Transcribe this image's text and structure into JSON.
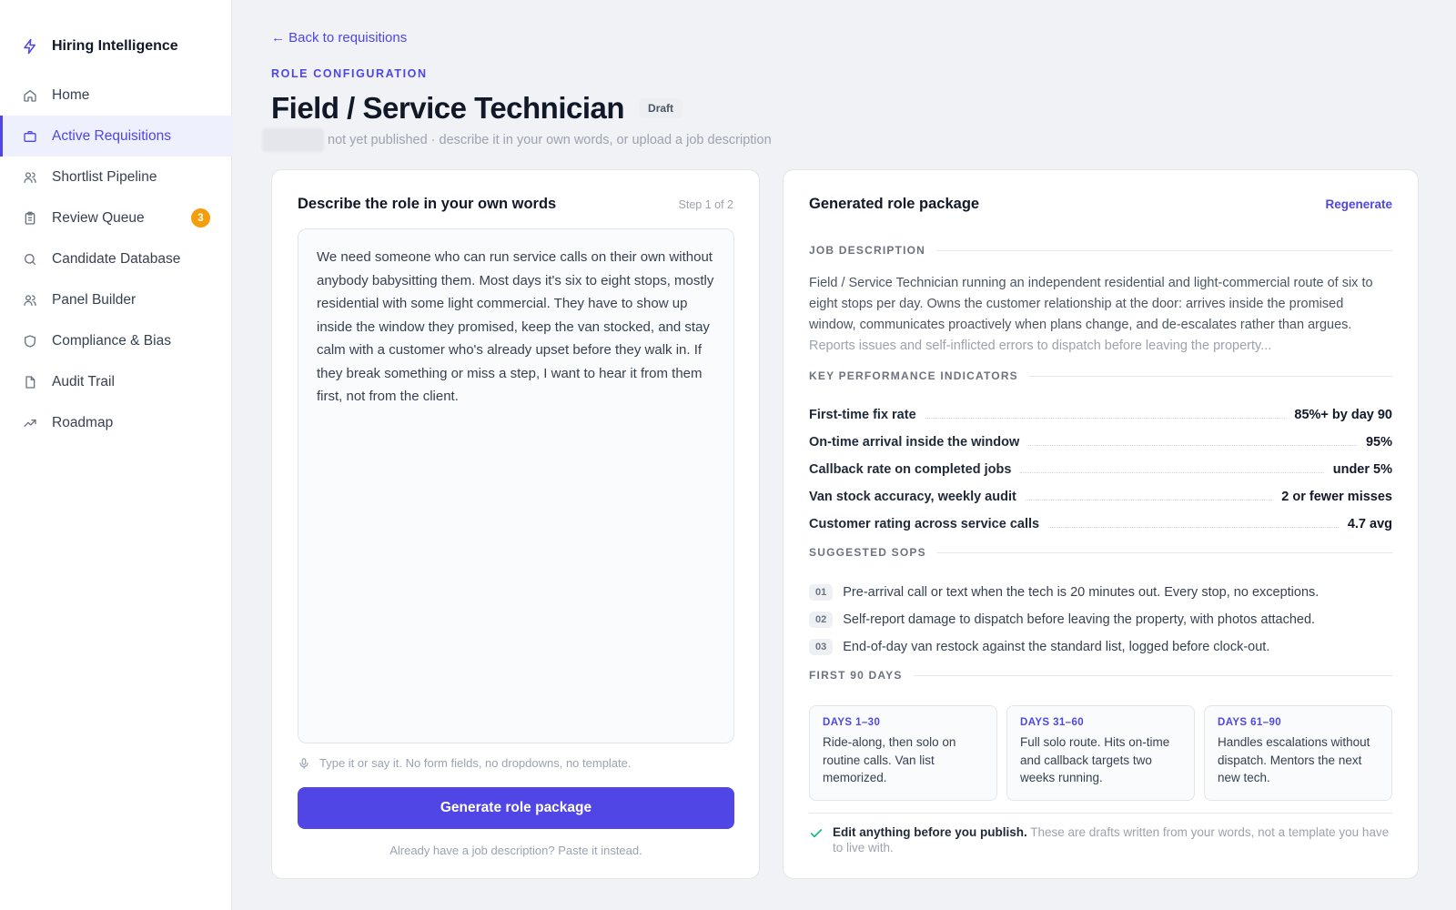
{
  "app": {
    "name": "Hiring Intelligence",
    "accent": "#4f46e5"
  },
  "sidebar": {
    "items": [
      {
        "label": "Home",
        "icon": "home-icon"
      },
      {
        "label": "Active Requisitions",
        "icon": "briefcase-icon",
        "active": true
      },
      {
        "label": "Shortlist Pipeline",
        "icon": "users-icon"
      },
      {
        "label": "Review Queue",
        "icon": "clipboard-icon",
        "badge": "3"
      },
      {
        "label": "Candidate Database",
        "icon": "search-icon"
      },
      {
        "label": "Panel Builder",
        "icon": "users-icon"
      },
      {
        "label": "Compliance & Bias",
        "icon": "shield-icon"
      },
      {
        "label": "Audit Trail",
        "icon": "file-icon"
      },
      {
        "label": "Roadmap",
        "icon": "trending-up-icon"
      }
    ]
  },
  "header": {
    "back_link": "← Back to requisitions",
    "eyebrow": "ROLE CONFIGURATION",
    "title": "Field / Service Technician",
    "status": "Draft",
    "subtitle": "not yet published · describe it in your own words, or upload a job description"
  },
  "left": {
    "title": "Describe the role in your own words",
    "step": "Step 1 of 2",
    "description": "We need someone who can run service calls on their own without anybody babysitting them. Most days it's six to eight stops, mostly residential with some light commercial. They have to show up inside the window they promised, keep the van stocked, and stay calm with a customer who's already upset before they walk in. If they break something or miss a step, I want to hear it from them first, not from the client.",
    "hint": "Type it or say it. No form fields, no dropdowns, no template.",
    "generate_label": "Generate role package",
    "paste_label": "Already have a job description? Paste it instead."
  },
  "right": {
    "title": "Generated role package",
    "regenerate_label": "Regenerate",
    "job_description": {
      "label": "JOB DESCRIPTION",
      "text": "Field / Service Technician running an independent residential and light-commercial route of six to eight stops per day. Owns the customer relationship at the door: arrives inside the promised window, communicates proactively when plans change, and de-escalates rather than argues.",
      "faded": "Reports issues and self-inflicted errors to dispatch before leaving the property..."
    },
    "kpis": {
      "label": "KEY PERFORMANCE INDICATORS",
      "rows": [
        {
          "name": "First-time fix rate",
          "value": "85%+ by day 90"
        },
        {
          "name": "On-time arrival inside the window",
          "value": "95%"
        },
        {
          "name": "Callback rate on completed jobs",
          "value": "under 5%"
        },
        {
          "name": "Van stock accuracy, weekly audit",
          "value": "2 or fewer misses"
        },
        {
          "name": "Customer rating across service calls",
          "value": "4.7 avg"
        }
      ]
    },
    "sops": {
      "label": "SUGGESTED SOPS",
      "rows": [
        {
          "num": "01",
          "text": "Pre-arrival call or text when the tech is 20 minutes out. Every stop, no exceptions."
        },
        {
          "num": "02",
          "text": "Self-report damage to dispatch before leaving the property, with photos attached."
        },
        {
          "num": "03",
          "text": "End-of-day van restock against the standard list, logged before clock-out."
        }
      ]
    },
    "first90": {
      "label": "FIRST 90 DAYS",
      "phases": [
        {
          "label": "DAYS 1–30",
          "text": "Ride-along, then solo on routine calls. Van list memorized."
        },
        {
          "label": "DAYS 31–60",
          "text": "Full solo route. Hits on-time and callback targets two weeks running."
        },
        {
          "label": "DAYS 61–90",
          "text": "Handles escalations without dispatch. Mentors the next new tech."
        }
      ]
    },
    "note": {
      "strong": "Edit anything before you publish.",
      "rest": " These are drafts written from your words, not a template you have to live with."
    }
  }
}
